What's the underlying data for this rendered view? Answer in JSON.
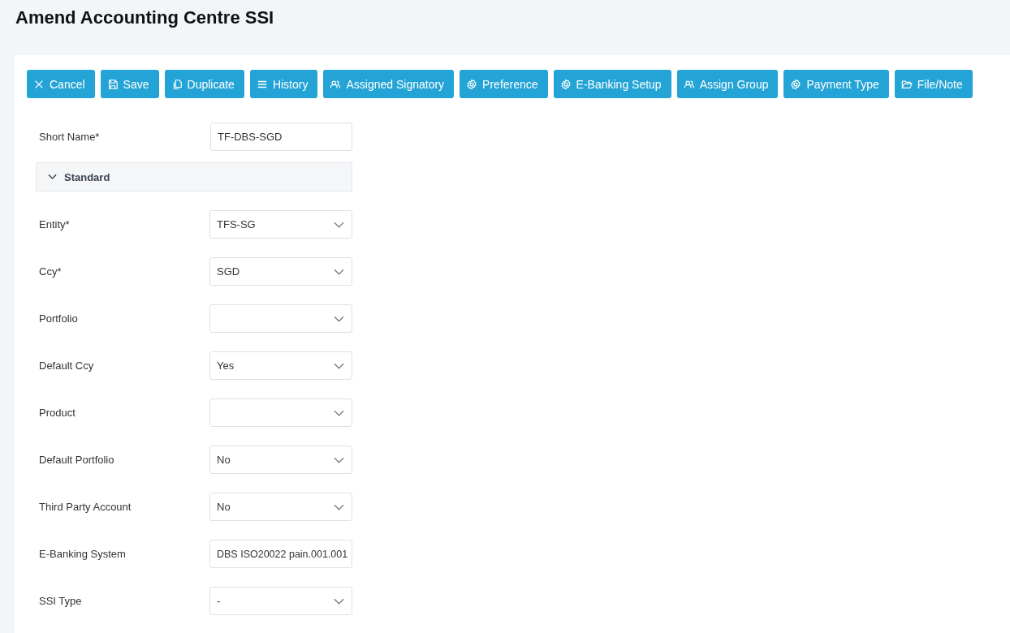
{
  "page": {
    "title": "Amend Accounting Centre SSI"
  },
  "toolbar": [
    {
      "label": "Cancel"
    },
    {
      "label": "Save"
    },
    {
      "label": "Duplicate"
    },
    {
      "label": "History"
    },
    {
      "label": "Assigned Signatory"
    },
    {
      "label": "Preference"
    },
    {
      "label": "E-Banking Setup"
    },
    {
      "label": "Assign Group"
    },
    {
      "label": "Payment Type"
    },
    {
      "label": "File/Note"
    }
  ],
  "short_name": {
    "label": "Short Name*",
    "value": "TF-DBS-SGD"
  },
  "section": {
    "title": "Standard",
    "expanded": true
  },
  "fields": [
    {
      "label": "Entity*",
      "kind": "select",
      "value": "TFS-SG"
    },
    {
      "label": "Ccy*",
      "kind": "select",
      "value": "SGD"
    },
    {
      "label": "Portfolio",
      "kind": "select"
    },
    {
      "label": "Default Ccy",
      "kind": "select",
      "value": "Yes"
    },
    {
      "label": "Product",
      "kind": "select"
    },
    {
      "label": "Default Portfolio",
      "kind": "select",
      "value": "No"
    },
    {
      "label": "Third Party Account",
      "kind": "select",
      "value": "No"
    },
    {
      "label": "E-Banking System",
      "kind": "text",
      "value": "DBS ISO20022 pain.001.001"
    },
    {
      "label": "SSI Type",
      "kind": "select",
      "value": "-"
    }
  ]
}
